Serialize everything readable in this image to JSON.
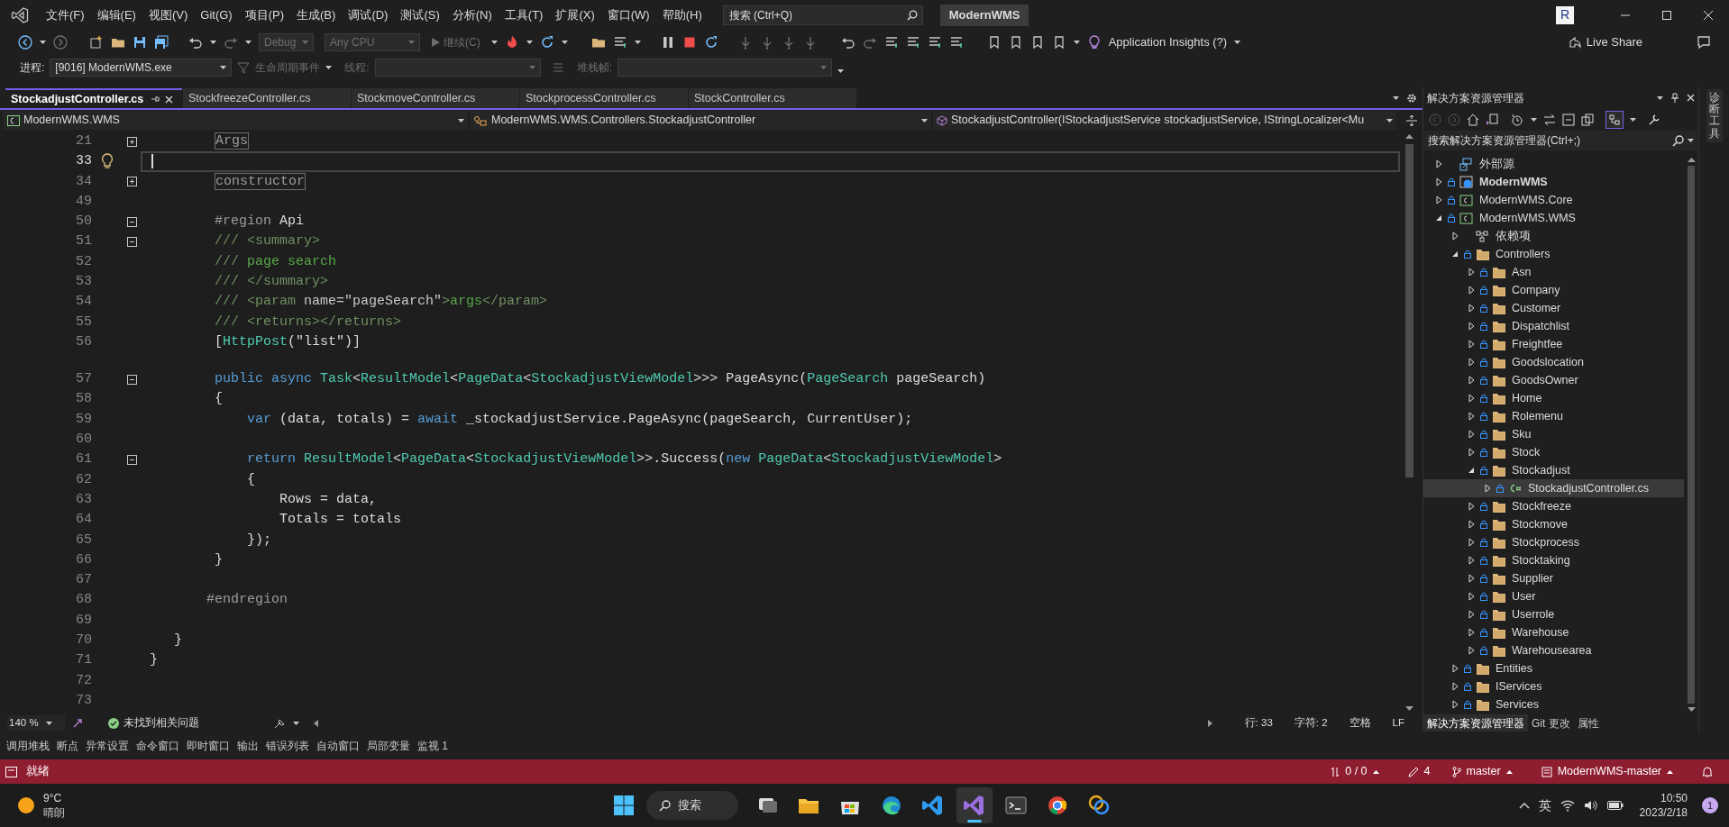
{
  "menu": {
    "items": [
      "文件(F)",
      "编辑(E)",
      "视图(V)",
      "Git(G)",
      "项目(P)",
      "生成(B)",
      "调试(D)",
      "测试(S)",
      "分析(N)",
      "工具(T)",
      "扩展(X)",
      "窗口(W)",
      "帮助(H)"
    ],
    "search": {
      "placeholder": "搜索 (Ctrl+Q)"
    },
    "solution_name": "ModernWMS",
    "account_initial": "R"
  },
  "toolbar": {
    "configuration": {
      "value": "Debug",
      "disabled": true
    },
    "platform": {
      "value": "Any CPU",
      "disabled": true
    },
    "continue": {
      "label": "继续(C)",
      "disabled": true
    },
    "insights": "Application Insights (?)",
    "live_share": "Live Share"
  },
  "debug_toolbar": {
    "process_label": "进程:",
    "process": "[9016] ModernWMS.exe",
    "lifecycle": {
      "label": "生命周期事件",
      "disabled": true
    },
    "thread": {
      "label": "线程:",
      "disabled": true
    },
    "stack_frame": {
      "label": "堆栈帧:",
      "disabled": true
    }
  },
  "tabs": [
    {
      "label": "StockadjustController.cs",
      "selected": true
    },
    {
      "label": "StockfreezeController.cs",
      "selected": false
    },
    {
      "label": "StockmoveController.cs",
      "selected": false
    },
    {
      "label": "StockprocessController.cs",
      "selected": false
    },
    {
      "label": "StockController.cs",
      "selected": false
    }
  ],
  "navigation": {
    "project": "ModernWMS.WMS",
    "type": "ModernWMS.WMS.Controllers.StockadjustController",
    "member": "StockadjustController(IStockadjustService stockadjustService, IStringLocalizer<Mu"
  },
  "code_lines": [
    {
      "number": "21",
      "expanded": false,
      "current": false,
      "tokens": [
        {
          "text": "        Args",
          "kind": "collapsed"
        }
      ]
    },
    {
      "number": "33",
      "current": true
    },
    {
      "number": "34",
      "expanded": false,
      "current": false,
      "tokens": [
        {
          "text": "        constructor",
          "kind": "collapsed"
        }
      ]
    },
    {
      "number": "49",
      "current": false
    },
    {
      "number": "50",
      "expanded": true,
      "current": false,
      "tokens": [
        {
          "text": "        #region",
          "kind": "preproc"
        },
        {
          "text": " Api",
          "kind": "plain"
        }
      ]
    },
    {
      "number": "51",
      "expanded": true,
      "current": false,
      "tokens": [
        {
          "text": "        /// <summary>",
          "kind": "doc"
        }
      ]
    },
    {
      "number": "52",
      "current": false,
      "tokens": [
        {
          "text": "        ///",
          "kind": "doc"
        },
        {
          "text": " page search",
          "kind": "comment"
        }
      ]
    },
    {
      "number": "53",
      "current": false,
      "tokens": [
        {
          "text": "        /// </summary>",
          "kind": "doc"
        }
      ]
    },
    {
      "number": "54",
      "current": false,
      "tokens": [
        {
          "text": "        /// <param ",
          "kind": "doc"
        },
        {
          "text": "name=\"pageSearch\"",
          "kind": "attr"
        },
        {
          "text": ">",
          "kind": "doc"
        },
        {
          "text": "args",
          "kind": "comment"
        },
        {
          "text": "</param>",
          "kind": "doc"
        }
      ]
    },
    {
      "number": "55",
      "current": false,
      "tokens": [
        {
          "text": "        /// <returns></returns>",
          "kind": "doc"
        }
      ]
    },
    {
      "number": "56",
      "current": false,
      "tokens": [
        {
          "text": "        [",
          "kind": "plain"
        },
        {
          "text": "HttpPost",
          "kind": "type"
        },
        {
          "text": "(\"list\")]",
          "kind": "plain"
        }
      ]
    },
    {
      "number": "57",
      "expanded": true,
      "current": false,
      "codelens": true,
      "tokens": [
        {
          "text": "        public async ",
          "kind": "keyword"
        },
        {
          "text": "Task",
          "kind": "type"
        },
        {
          "text": "<",
          "kind": "plain"
        },
        {
          "text": "ResultModel",
          "kind": "type"
        },
        {
          "text": "<",
          "kind": "plain"
        },
        {
          "text": "PageData",
          "kind": "type"
        },
        {
          "text": "<",
          "kind": "plain"
        },
        {
          "text": "StockadjustViewModel",
          "kind": "type"
        },
        {
          "text": ">>> PageAsync(",
          "kind": "plain"
        },
        {
          "text": "PageSearch",
          "kind": "type"
        },
        {
          "text": " pageSearch)",
          "kind": "plain"
        }
      ]
    },
    {
      "number": "58",
      "current": false,
      "tokens": [
        {
          "text": "        {",
          "kind": "plain"
        }
      ]
    },
    {
      "number": "59",
      "current": false,
      "tokens": [
        {
          "text": "            var",
          "kind": "keyword"
        },
        {
          "text": " (data, totals) = ",
          "kind": "plain"
        },
        {
          "text": "await",
          "kind": "keyword"
        },
        {
          "text": " _stockadjustService.PageAsync(pageSearch, CurrentUser);",
          "kind": "plain"
        }
      ]
    },
    {
      "number": "60",
      "current": false
    },
    {
      "number": "61",
      "expanded": true,
      "current": false,
      "tokens": [
        {
          "text": "            return ",
          "kind": "keyword"
        },
        {
          "text": "ResultModel",
          "kind": "type"
        },
        {
          "text": "<",
          "kind": "plain"
        },
        {
          "text": "PageData",
          "kind": "type"
        },
        {
          "text": "<",
          "kind": "plain"
        },
        {
          "text": "StockadjustViewModel",
          "kind": "type"
        },
        {
          "text": ">>.Success(",
          "kind": "plain"
        },
        {
          "text": "new ",
          "kind": "keyword"
        },
        {
          "text": "PageData",
          "kind": "type"
        },
        {
          "text": "<",
          "kind": "plain"
        },
        {
          "text": "StockadjustViewModel",
          "kind": "type"
        },
        {
          "text": ">",
          "kind": "plain"
        }
      ]
    },
    {
      "number": "62",
      "current": false,
      "tokens": [
        {
          "text": "            {",
          "kind": "plain"
        }
      ]
    },
    {
      "number": "63",
      "current": false,
      "tokens": [
        {
          "text": "                Rows = data,",
          "kind": "plain"
        }
      ]
    },
    {
      "number": "64",
      "current": false,
      "tokens": [
        {
          "text": "                Totals = totals",
          "kind": "plain"
        }
      ]
    },
    {
      "number": "65",
      "current": false,
      "tokens": [
        {
          "text": "            });",
          "kind": "plain"
        }
      ]
    },
    {
      "number": "66",
      "current": false,
      "tokens": [
        {
          "text": "        }",
          "kind": "plain"
        }
      ]
    },
    {
      "number": "67",
      "current": false
    },
    {
      "number": "68",
      "current": false,
      "tokens": [
        {
          "text": "       #endregion",
          "kind": "preproc"
        }
      ]
    },
    {
      "number": "69",
      "current": false
    },
    {
      "number": "70",
      "current": false,
      "tokens": [
        {
          "text": "   }",
          "kind": "plain"
        }
      ]
    },
    {
      "number": "71",
      "current": false,
      "tokens": [
        {
          "text": "}",
          "kind": "plain"
        }
      ]
    },
    {
      "number": "72",
      "current": false
    },
    {
      "number": "73",
      "current": false
    }
  ],
  "editor_status": {
    "zoom": "140 %",
    "issues": "未找到相关问题",
    "line": "行: 33",
    "column": "字符: 2",
    "indent": "空格",
    "line_ending": "LF"
  },
  "solution_explorer": {
    "title": "解决方案资源管理器",
    "search": {
      "placeholder": "搜索解决方案资源管理器(Ctrl+;)"
    },
    "tree": [
      {
        "label": "外部源",
        "kind": "external",
        "locked": false,
        "expanded": false,
        "selected": false
      },
      {
        "label": "ModernWMS",
        "kind": "web",
        "locked": true,
        "expanded": false,
        "selected": false,
        "startup": true
      },
      {
        "label": "ModernWMS.Core",
        "kind": "csproj",
        "locked": true,
        "expanded": false,
        "selected": false
      },
      {
        "label": "ModernWMS.WMS",
        "kind": "csproj",
        "locked": true,
        "expanded": true,
        "selected": false,
        "children": [
          {
            "label": "依赖项",
            "kind": "deps",
            "locked": false,
            "expanded": false,
            "selected": false
          },
          {
            "label": "Controllers",
            "kind": "folder",
            "locked": true,
            "expanded": true,
            "selected": false,
            "children": [
              {
                "label": "Asn",
                "kind": "folder",
                "locked": true,
                "expanded": false,
                "selected": false
              },
              {
                "label": "Company",
                "kind": "folder",
                "locked": true,
                "expanded": false,
                "selected": false
              },
              {
                "label": "Customer",
                "kind": "folder",
                "locked": true,
                "expanded": false,
                "selected": false
              },
              {
                "label": "Dispatchlist",
                "kind": "folder",
                "locked": true,
                "expanded": false,
                "selected": false
              },
              {
                "label": "Freightfee",
                "kind": "folder",
                "locked": true,
                "expanded": false,
                "selected": false
              },
              {
                "label": "Goodslocation",
                "kind": "folder",
                "locked": true,
                "expanded": false,
                "selected": false
              },
              {
                "label": "GoodsOwner",
                "kind": "folder",
                "locked": true,
                "expanded": false,
                "selected": false
              },
              {
                "label": "Home",
                "kind": "folder",
                "locked": true,
                "expanded": false,
                "selected": false
              },
              {
                "label": "Rolemenu",
                "kind": "folder",
                "locked": true,
                "expanded": false,
                "selected": false
              },
              {
                "label": "Sku",
                "kind": "folder",
                "locked": true,
                "expanded": false,
                "selected": false
              },
              {
                "label": "Stock",
                "kind": "folder",
                "locked": true,
                "expanded": false,
                "selected": false
              },
              {
                "label": "Stockadjust",
                "kind": "folder",
                "locked": true,
                "expanded": true,
                "selected": false,
                "children": [
                  {
                    "label": "StockadjustController.cs",
                    "kind": "csfile",
                    "locked": true,
                    "expanded": false,
                    "selected": true
                  }
                ]
              },
              {
                "label": "Stockfreeze",
                "kind": "folder",
                "locked": true,
                "expanded": false,
                "selected": false
              },
              {
                "label": "Stockmove",
                "kind": "folder",
                "locked": true,
                "expanded": false,
                "selected": false
              },
              {
                "label": "Stockprocess",
                "kind": "folder",
                "locked": true,
                "expanded": false,
                "selected": false
              },
              {
                "label": "Stocktaking",
                "kind": "folder",
                "locked": true,
                "expanded": false,
                "selected": false
              },
              {
                "label": "Supplier",
                "kind": "folder",
                "locked": true,
                "expanded": false,
                "selected": false
              },
              {
                "label": "User",
                "kind": "folder",
                "locked": true,
                "expanded": false,
                "selected": false
              },
              {
                "label": "Userrole",
                "kind": "folder",
                "locked": true,
                "expanded": false,
                "selected": false
              },
              {
                "label": "Warehouse",
                "kind": "folder",
                "locked": true,
                "expanded": false,
                "selected": false
              },
              {
                "label": "Warehousearea",
                "kind": "folder",
                "locked": true,
                "expanded": false,
                "selected": false
              }
            ]
          },
          {
            "label": "Entities",
            "kind": "folder",
            "locked": true,
            "expanded": false,
            "selected": false
          },
          {
            "label": "IServices",
            "kind": "folder",
            "locked": true,
            "expanded": false,
            "selected": false
          },
          {
            "label": "Services",
            "kind": "folder",
            "locked": true,
            "expanded": false,
            "selected": false
          }
        ]
      }
    ],
    "tabs": [
      {
        "label": "解决方案资源管理器",
        "selected": true
      },
      {
        "label": "Git 更改",
        "selected": false
      },
      {
        "label": "属性",
        "selected": false
      }
    ]
  },
  "side_tabs": [
    "诊断工具"
  ],
  "tool_tabs": [
    "调用堆栈",
    "断点",
    "异常设置",
    "命令窗口",
    "即时窗口",
    "输出",
    "错误列表",
    "自动窗口",
    "局部变量",
    "监视 1"
  ],
  "status_bar": {
    "message": "就绪",
    "changes": "0 / 0",
    "edits": "4",
    "branch": "master",
    "repository": "ModernWMS-master"
  },
  "taskbar": {
    "temperature": "9°C",
    "weather": "晴朗",
    "search": "搜索",
    "apps": [
      {
        "kind": "task-view",
        "active": false
      },
      {
        "kind": "explorer",
        "active": false
      },
      {
        "kind": "store",
        "active": false
      },
      {
        "kind": "edge",
        "active": false
      },
      {
        "kind": "vscode",
        "active": false
      },
      {
        "kind": "visual-studio",
        "active": true
      },
      {
        "kind": "terminal",
        "active": false
      },
      {
        "kind": "chrome",
        "active": false
      },
      {
        "kind": "paint",
        "active": false
      }
    ],
    "input_method": "英",
    "time": "10:50",
    "date": "2023/2/18",
    "notifications": "1"
  }
}
